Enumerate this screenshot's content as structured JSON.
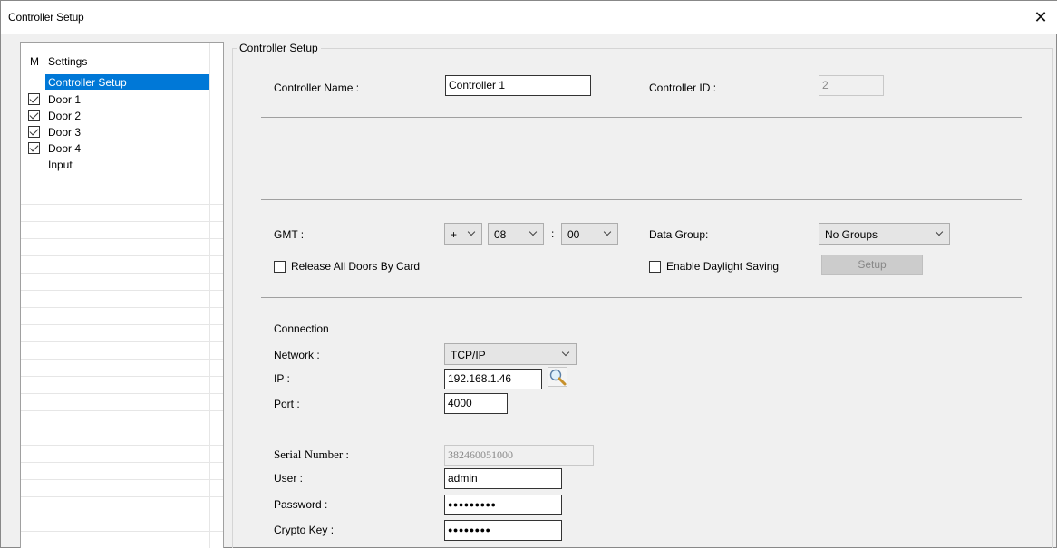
{
  "window": {
    "title": "Controller Setup",
    "close_symbol": "✕"
  },
  "settings_list": {
    "header_m": "M",
    "header_settings": "Settings",
    "items": [
      {
        "label": "Controller Setup",
        "checked": null,
        "selected": true
      },
      {
        "label": "Door 1",
        "checked": true
      },
      {
        "label": "Door 2",
        "checked": true
      },
      {
        "label": "Door 3",
        "checked": true
      },
      {
        "label": "Door 4",
        "checked": true
      },
      {
        "label": "Input",
        "checked": null
      }
    ]
  },
  "group": {
    "legend": "Controller Setup",
    "controller_name_label": "Controller Name :",
    "controller_name_value": "Controller 1",
    "controller_id_label": "Controller ID :",
    "controller_id_value": "2",
    "gmt_label": "GMT :",
    "gmt_sign": "+",
    "gmt_hours": "08",
    "gmt_colon": ":",
    "gmt_minutes": "00",
    "data_group_label": "Data Group:",
    "data_group_value": "No Groups",
    "release_all_doors_label": "Release All Doors By Card",
    "enable_daylight_label": "Enable Daylight Saving",
    "setup_button": "Setup",
    "connection_label": "Connection",
    "network_label": "Network :",
    "network_value": "TCP/IP",
    "ip_label": "IP :",
    "ip_value": "192.168.1.46",
    "port_label": "Port :",
    "port_value": "4000",
    "serial_label": "Serial Number :",
    "serial_value": "382460051000",
    "user_label": "User :",
    "user_value": "admin",
    "password_label": "Password :",
    "password_value": "●●●●●●●●●",
    "crypto_label": "Crypto Key :",
    "crypto_value": "●●●●●●●●"
  },
  "icons": {
    "close": "close-icon",
    "search": "search-icon",
    "checkbox": "checkbox-icon",
    "dropdown": "chevron-down-icon"
  },
  "colors": {
    "selection": "#0078d7",
    "window_bg": "#f0f0f0"
  }
}
